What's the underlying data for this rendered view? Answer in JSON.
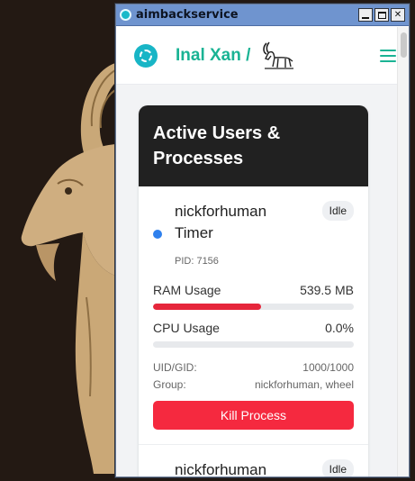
{
  "window": {
    "title": "aimbackservice"
  },
  "header": {
    "brand": "Inal Xan /"
  },
  "card": {
    "title": "Active Users & Processes",
    "processes": [
      {
        "user": "nickforhuman",
        "name": "Timer",
        "status": "Idle",
        "pid": "PID: 7156",
        "ram_label": "RAM Usage",
        "ram_value": "539.5 MB",
        "ram_fraction": 0.54,
        "cpu_label": "CPU Usage",
        "cpu_value": "0.0%",
        "cpu_fraction": 0.0,
        "uid_label": "UID/GID:",
        "uid_value": "1000/1000",
        "group_label": "Group:",
        "group_value": "nickforhuman, wheel",
        "kill_label": "Kill Process"
      },
      {
        "user": "nickforhuman",
        "status": "Idle"
      }
    ]
  },
  "colors": {
    "brand": "#1ab394",
    "danger": "#f5293f",
    "status_dot": "#2f80ed",
    "titlebar": "#6f94cf"
  },
  "icons": [
    "app-icon",
    "logo-icon",
    "goat-icon",
    "menu-icon",
    "minimize-icon",
    "maximize-icon",
    "close-icon",
    "status-dot-icon"
  ]
}
